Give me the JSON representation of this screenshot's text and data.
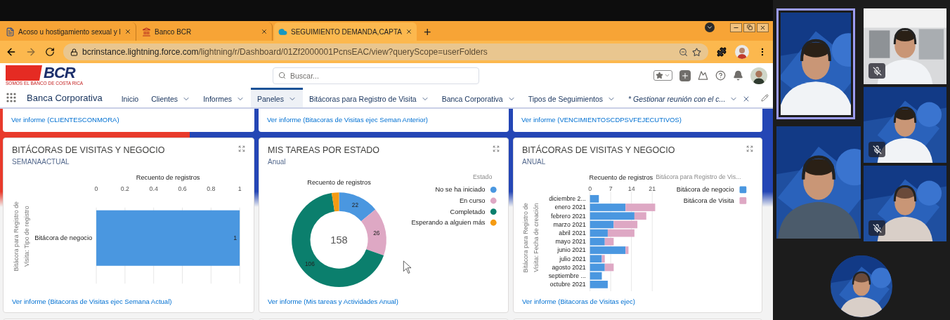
{
  "browser": {
    "tabs": [
      {
        "title": "Acoso u hostigamiento sexual y l",
        "selected": false
      },
      {
        "title": "Banco BCR",
        "selected": false
      },
      {
        "title": "SEGUIMIENTO DEMANDA,CAPTA",
        "selected": true
      }
    ],
    "new_tab": "+",
    "url_host": "bcrinstance.lightning.force.com",
    "url_path": "/lightning/r/Dashboard/01Zf2000001PcnsEAC/view?queryScope=userFolders"
  },
  "header": {
    "logo": "BCR",
    "logo_tagline": "SOMOS EL BANCO DE COSTA RICA",
    "search": {
      "placeholder": "Buscar..."
    }
  },
  "nav": {
    "app_name": "Banca Corporativa",
    "items": [
      {
        "label": "Inicio",
        "kind": "tab",
        "dropdown": false,
        "selected": false
      },
      {
        "label": "Clientes",
        "kind": "tab",
        "dropdown": true,
        "selected": false
      },
      {
        "label": "Informes",
        "kind": "tab",
        "dropdown": true,
        "selected": false
      },
      {
        "label": "Paneles",
        "kind": "tab",
        "dropdown": true,
        "selected": true
      },
      {
        "label": "Bitácoras para Registro de Visita",
        "kind": "tab",
        "dropdown": true,
        "selected": false
      },
      {
        "label": "Banca Corporativa",
        "kind": "tab",
        "dropdown": true,
        "selected": false
      },
      {
        "label": "Tipos de Seguimientos",
        "kind": "tab",
        "dropdown": true,
        "selected": false
      },
      {
        "label": "* Gestionar reunión con el c...",
        "kind": "record",
        "dropdown": true,
        "selected": false
      }
    ]
  },
  "top_cards": [
    {
      "link": "Ver informe (CLIENTESCONMORA)"
    },
    {
      "link": "Ver informe (Bitacoras de Visitas ejec Seman Anterior)"
    },
    {
      "link": "Ver informe (VENCIMIENTOSCDPSVFEJECUTIVOS)"
    }
  ],
  "widgets": [
    {
      "title": "BITÁCORAS DE VISITAS Y NEGOCIO",
      "subtitle": "SEMANAACTUAL",
      "link": "Ver informe (Bitacoras de Visitas ejec Semana Actual)",
      "chart_data": {
        "type": "bar",
        "orientation": "horizontal",
        "grid": true,
        "xlabel": "Recuento de registros",
        "ylabel": "Bitácora para Registro de Visita: Tipo de registro",
        "categories": [
          "Bitácora de negocio"
        ],
        "series": [
          {
            "color": "#4a97e0",
            "values": [
              1
            ]
          }
        ],
        "xlim": [
          0,
          1
        ],
        "xticks": [
          0,
          {
            "value": 0.2,
            "label": "0.2"
          },
          {
            "value": 0.4,
            "label": "0.4"
          },
          {
            "value": 0.6,
            "label": "0.6"
          },
          {
            "value": 0.8,
            "label": "0.8"
          },
          1
        ],
        "data_labels": true
      }
    },
    {
      "title": "MIS TAREAS POR ESTADO",
      "subtitle": "Anual",
      "link": "Ver informe (Mis tareas y Actividades Anual)",
      "center_label": "158",
      "chart_data": {
        "type": "donut",
        "title": "Recuento de registros",
        "categories": [
          "No se ha iniciado",
          "En curso",
          "Completado",
          "Esperando a alguien más"
        ],
        "series": [
          {
            "values": [
              13.9,
              16.5,
              67.1,
              2.5
            ]
          }
        ],
        "colors": [
          "#4a97e0",
          "#dea8c4",
          "#0b7f6d",
          "#f59b12"
        ],
        "legend": {
          "title": "Estado"
        },
        "value_labels": [
          "22",
          "26",
          "106",
          null
        ]
      }
    },
    {
      "title": "BITÁCORAS DE VISITAS Y NEGOCIO",
      "subtitle": "ANUAL",
      "link": "Ver informe (Bitacoras de Visitas ejec)",
      "chart_data": {
        "type": "bar",
        "orientation": "horizontal",
        "stacked": true,
        "grid": true,
        "xlabel": "Recuento de registros",
        "ylabel": "Bitácora para Registro de Visita: Fecha de creación",
        "categories": [
          "diciembre 2...",
          "enero 2021",
          "febrero 2021",
          "marzo 2021",
          "abril 2021",
          "mayo 2021",
          "junio 2021",
          "julio 2021",
          "agosto 2021",
          "septiembre ...",
          "octubre 2021"
        ],
        "series": [
          {
            "name": "Bitácora de negocio",
            "color": "#4a97e0",
            "values": [
              3,
              12,
              15,
              8,
              6,
              5,
              12,
              4,
              5,
              4,
              6
            ]
          },
          {
            "name": "Bitácora de Visita",
            "color": "#dea8c4",
            "values": [
              0,
              10,
              4,
              8,
              9,
              3,
              1,
              1,
              3,
              0,
              0
            ]
          }
        ],
        "legend": {
          "title": "Bitácora para Registro de Vis..."
        },
        "xlim": [
          0,
          22.5
        ],
        "xticks": [
          0,
          7,
          14,
          21
        ]
      }
    }
  ],
  "meeting": {
    "participants": [
      {
        "kind": "picture",
        "active": true,
        "muted": false
      },
      {
        "kind": "picture",
        "active": false,
        "muted": true
      },
      {
        "kind": "picture",
        "active": false,
        "muted": true
      },
      {
        "kind": "picture",
        "active": false,
        "muted": false
      },
      {
        "kind": "picture",
        "active": false,
        "muted": true
      }
    ],
    "self_view": {
      "kind": "picture"
    }
  }
}
